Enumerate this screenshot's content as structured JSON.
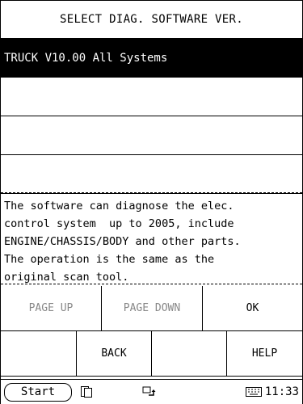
{
  "title": "SELECT DIAG. SOFTWARE VER.",
  "list": {
    "items": [
      {
        "label": "TRUCK V10.00 All Systems",
        "selected": true
      },
      {
        "label": "",
        "selected": false
      },
      {
        "label": "",
        "selected": false
      },
      {
        "label": "",
        "selected": false
      }
    ]
  },
  "description": "The software can diagnose the elec.\ncontrol system  up to 2005, include\nENGINE/CHASSIS/BODY and other parts.\nThe operation is the same as the\noriginal scan tool.",
  "buttons": {
    "page_up": "PAGE UP",
    "page_down": "PAGE DOWN",
    "ok": "OK",
    "back": "BACK",
    "help": "HELP"
  },
  "taskbar": {
    "start": "Start",
    "time": "11:33",
    "icons": [
      "windows-icon",
      "sync-icon",
      "keyboard-icon"
    ]
  }
}
